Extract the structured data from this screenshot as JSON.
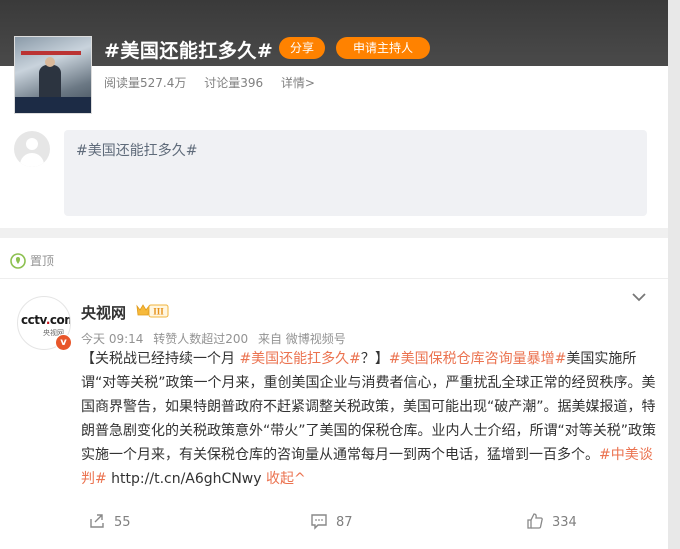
{
  "topic": {
    "title": "#美国还能扛多久#",
    "share_label": "分享",
    "host_label": "申请主持人",
    "reads": "阅读量527.4万",
    "discussions": "讨论量396",
    "details": "详情>"
  },
  "compose": {
    "text": "#美国还能扛多久#"
  },
  "post": {
    "pinned_label": "置顶",
    "author": "央视网",
    "level": "III",
    "avatar_logo": "cctv.com",
    "avatar_sub": "央视网",
    "verified_mark": "v",
    "meta": {
      "time": "今天 09:14",
      "reposts_note": "转赞人数超过200",
      "source": "来自 微博视频号"
    },
    "text_parts": {
      "p1": "【关税战已经持续一个月 ",
      "tag1": "#美国还能扛多久#",
      "p2": "？】",
      "tag2": "#美国保税仓库咨询量暴增#",
      "p3": "美国实施所谓“对等关税”政策一个月来，重创美国企业与消费者信心，严重扰乱全球正常的经贸秩序。美国商界警告，如果特朗普政府不赶紧调整关税政策，美国可能出现“破产潮”。据美媒报道，特朗普急剧变化的关税政策意外“带火”了美国的保税仓库。业内人士介绍，所谓“对等关税”政策实施一个月来，有关保税仓库的咨询量从通常每月一到两个电话，猛增到一百多个。",
      "tag3": "#中美谈判#",
      "link": " http://t.cn/A6ghCNwy ",
      "collapse": "收起^"
    },
    "actions": {
      "reposts": "55",
      "comments": "87",
      "likes": "334"
    }
  },
  "colors": {
    "accent": "#ff8200",
    "topic_link": "#eb7350",
    "header_bg": "#3a3a3a"
  }
}
